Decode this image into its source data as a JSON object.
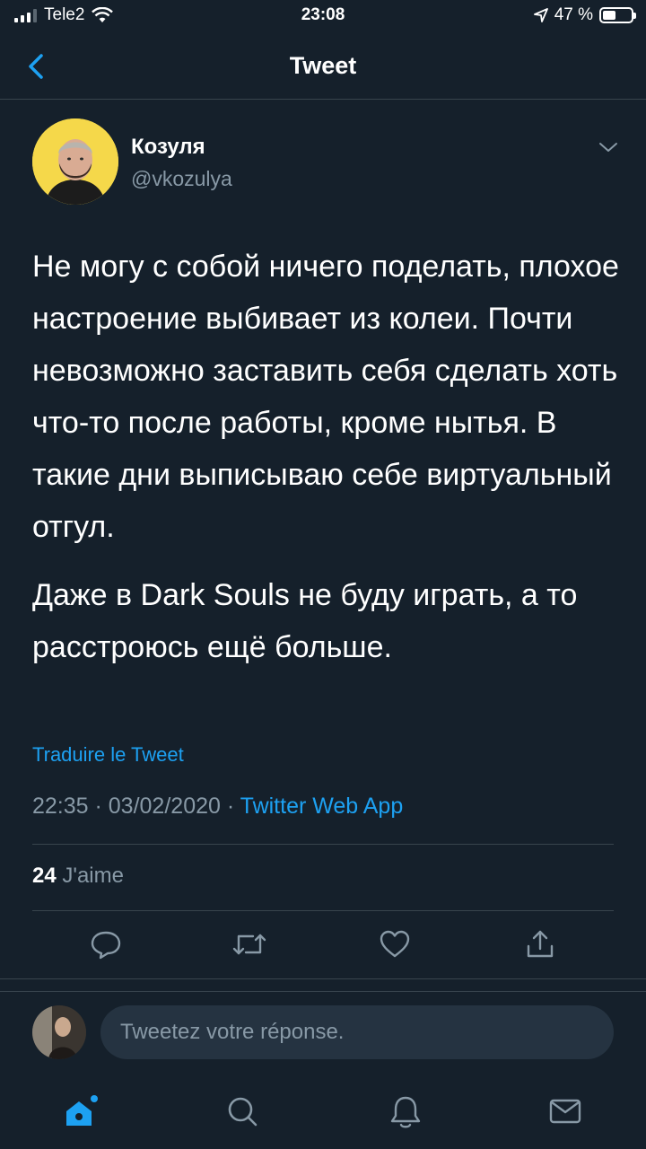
{
  "status_bar": {
    "carrier": "Tele2",
    "time": "23:08",
    "battery_percent_label": "47 %",
    "battery_level": 0.47
  },
  "nav": {
    "title": "Tweet"
  },
  "author": {
    "name": "Козуля",
    "handle": "@vkozulya"
  },
  "tweet": {
    "paragraphs": [
      "Не могу с собой ничего поделать, плохое настроение выбивает из колеи. Почти невозможно заставить себя сделать хоть что-то после работы, кроме нытья. В такие дни выписываю себе виртуальный отгул.",
      "Даже в Dark Souls не буду играть, а то расстроюсь ещё больше."
    ],
    "translate_label": "Traduire le Tweet",
    "timestamp": "22:35 · 03/02/2020 · ",
    "source": "Twitter Web App"
  },
  "stats": {
    "likes_count": "24",
    "likes_label": "J'aime"
  },
  "actions": [
    "reply-icon",
    "retweet-icon",
    "like-icon",
    "share-icon"
  ],
  "reply": {
    "placeholder": "Tweetez votre réponse."
  },
  "tabs": [
    "home-icon",
    "search-icon",
    "notifications-icon",
    "messages-icon"
  ],
  "colors": {
    "background": "#15202b",
    "accent": "#1da1f2",
    "secondary_text": "#8899a6",
    "divider": "#38444d",
    "avatar_bg": "#f5d84a"
  }
}
